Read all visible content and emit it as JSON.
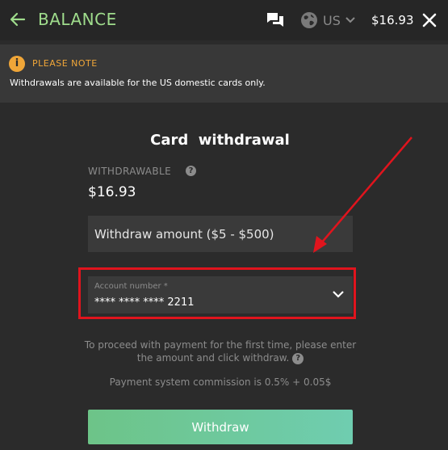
{
  "header": {
    "title": "BALANCE",
    "region": "US",
    "balance": "$16.93"
  },
  "notice": {
    "title": "PLEASE NOTE",
    "text": "Withdrawals are available for the US domestic cards only."
  },
  "withdrawal": {
    "title": "Card  withdrawal",
    "withdrawable_label": "WITHDRAWABLE",
    "withdrawable_value": "$16.93",
    "amount_placeholder": "Withdraw amount ($5 - $500)",
    "account_label": "Account number *",
    "account_value": "**** **** **** 2211",
    "info_text": "To proceed with payment for the first time, please enter the amount and click withdraw.",
    "commission_text": "Payment system commission is 0.5% + 0.05$",
    "button_label": "Withdraw"
  },
  "icons": {
    "back": "arrow-left-icon",
    "chat": "chat-icon",
    "globe": "globe-icon",
    "close": "close-icon",
    "info": "info-icon",
    "help": "question-icon",
    "dropdown": "chevron-down-icon"
  },
  "colors": {
    "accent_green": "#9fdc8c",
    "notice_orange": "#f0a638",
    "annotation_red": "#e0141d",
    "button_start": "#6dc488",
    "button_end": "#6fcdb0"
  }
}
